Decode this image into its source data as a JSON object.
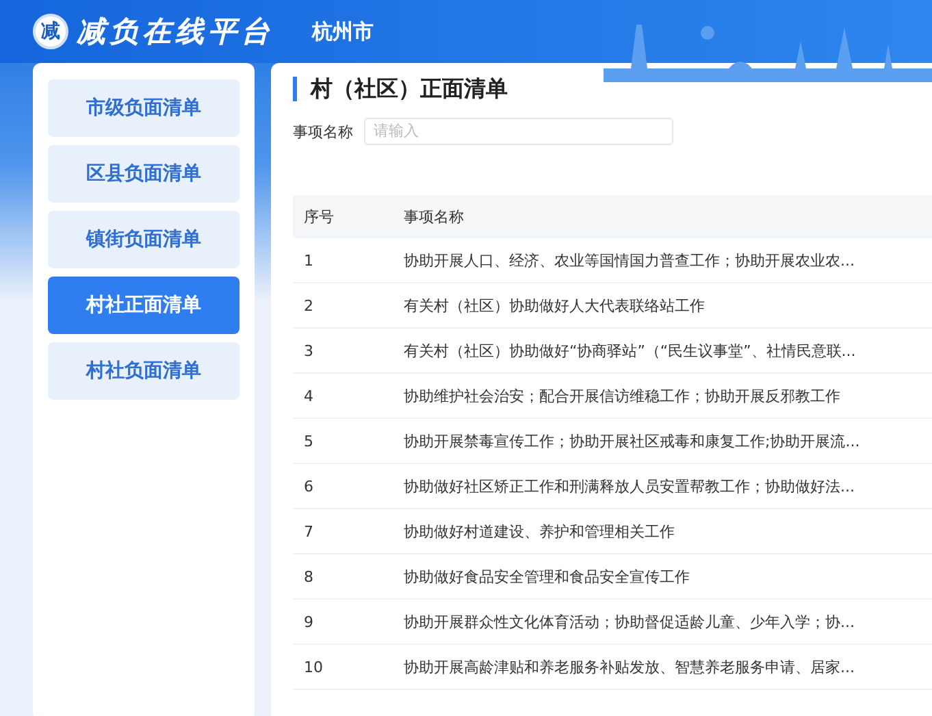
{
  "header": {
    "logo_mark": "减",
    "title": "减负在线平台",
    "city": "杭州市"
  },
  "sidebar": {
    "items": [
      {
        "label": "市级负面清单",
        "selected": false
      },
      {
        "label": "区县负面清单",
        "selected": false
      },
      {
        "label": "镇街负面清单",
        "selected": false
      },
      {
        "label": "村社正面清单",
        "selected": true
      },
      {
        "label": "村社负面清单",
        "selected": false
      }
    ]
  },
  "main": {
    "title": "村（社区）正面清单",
    "filter": {
      "label": "事项名称",
      "placeholder": "请输入"
    },
    "table": {
      "columns": [
        "序号",
        "事项名称"
      ],
      "rows": [
        [
          "1",
          "协助开展人口、经济、农业等国情国力普查工作；协助开展农业农..."
        ],
        [
          "2",
          "有关村（社区）协助做好人大代表联络站工作"
        ],
        [
          "3",
          "有关村（社区）协助做好“协商驿站”（“民生议事堂”、社情民意联..."
        ],
        [
          "4",
          "协助维护社会治安；配合开展信访维稳工作；协助开展反邪教工作"
        ],
        [
          "5",
          "协助开展禁毒宣传工作；协助开展社区戒毒和康复工作;协助开展流..."
        ],
        [
          "6",
          "协助做好社区矫正工作和刑满释放人员安置帮教工作；协助做好法..."
        ],
        [
          "7",
          "协助做好村道建设、养护和管理相关工作"
        ],
        [
          "8",
          "协助做好食品安全管理和食品安全宣传工作"
        ],
        [
          "9",
          "协助开展群众性文化体育活动；协助督促适龄儿童、少年入学；协..."
        ],
        [
          "10",
          "协助开展高龄津贴和养老服务补贴发放、智慧养老服务申请、居家..."
        ]
      ]
    }
  }
}
